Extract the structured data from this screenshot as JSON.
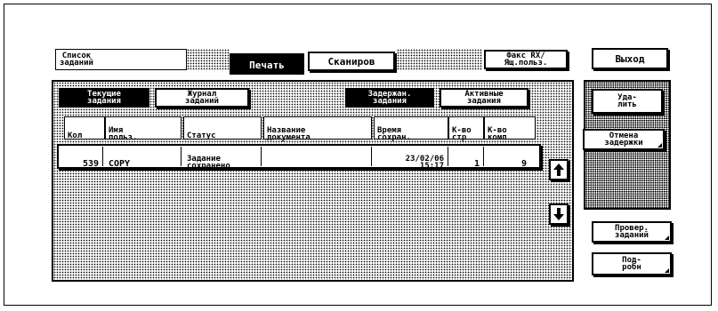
{
  "header": {
    "job_list_label": "Список\nзаданий",
    "tab_print": "Печать",
    "tab_scan": "Сканиров",
    "fax_label": "Факс RX/\nЯщ.польз.",
    "exit_label": "Выход"
  },
  "subtabs": {
    "current_jobs": "Текущие\nзадания",
    "job_log": "Журнал\nзаданий",
    "held_jobs": "Задержан.\nзадания",
    "active_jobs": "Активные\nзадания"
  },
  "table": {
    "columns": [
      "Кол",
      "Имя\nпольз.",
      "Статус",
      "Название\nдокумента",
      "Время\nсохран.",
      "К-во\nстр",
      "К-во\nкомп"
    ],
    "rows": [
      {
        "num": "539",
        "user": "COPY",
        "status": "Задание\nсохранено",
        "doc_name": "",
        "time": "23/02/06\n15:17",
        "pages": "1",
        "copies": "9"
      }
    ]
  },
  "side_buttons": {
    "delete": "Уда-\nлить",
    "cancel_hold": "Отмена\nзадержки",
    "check_jobs": "Провер.\nзаданий",
    "details": "Под-\nробн"
  },
  "icons": [
    "arrow-up-icon",
    "arrow-down-icon"
  ],
  "colors": {
    "foreground": "#000000",
    "background": "#ffffff"
  }
}
